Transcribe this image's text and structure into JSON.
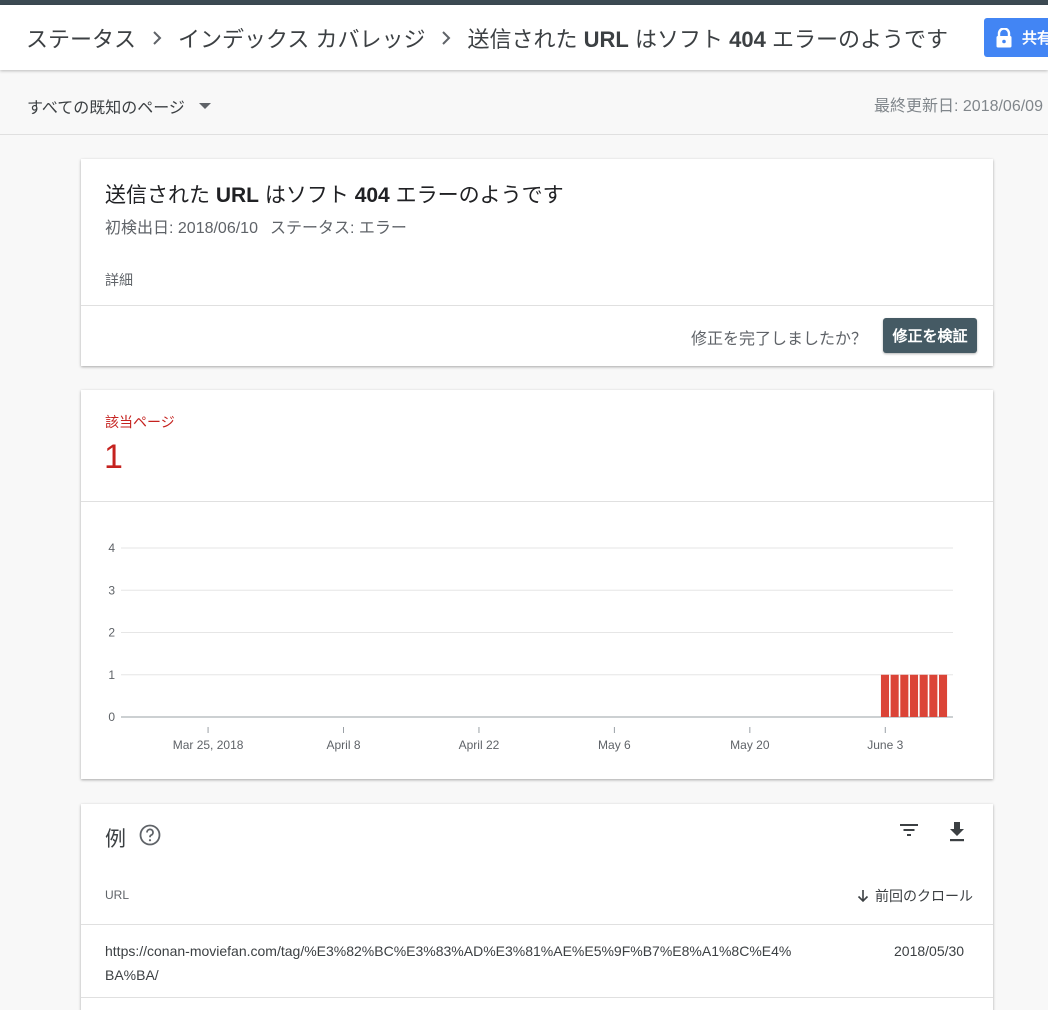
{
  "breadcrumb": {
    "items": [
      "ステータス",
      "インデックス カバレッジ"
    ],
    "current_prefix": "送信された",
    "current_bold1": "URL",
    "current_mid": "はソフト",
    "current_bold2": "404",
    "current_suffix": "エラーのようです"
  },
  "share_button": {
    "label": "共有"
  },
  "subbar": {
    "filter_label": "すべての既知のページ",
    "last_updated": "最終更新日: 2018/06/09"
  },
  "issue": {
    "title_prefix": "送信された",
    "title_bold1": "URL",
    "title_mid": "はソフト",
    "title_bold2": "404",
    "title_suffix": "エラーのようです",
    "first_detected": "初検出日: 2018/06/10",
    "status": "ステータス: エラー",
    "details_label": "詳細",
    "fix_question": "修正を完了しましたか？",
    "validate_button": "修正を検証"
  },
  "affected": {
    "label": "該当ページ",
    "count": "1",
    "color": "#c5221f"
  },
  "chart_data": {
    "type": "bar",
    "x_start": "2018-03-16",
    "x_end": "2018-06-10",
    "x_ticks": [
      {
        "label": "Mar 25, 2018",
        "date": "2018-03-25"
      },
      {
        "label": "April 8",
        "date": "2018-04-08"
      },
      {
        "label": "April 22",
        "date": "2018-04-22"
      },
      {
        "label": "May 6",
        "date": "2018-05-06"
      },
      {
        "label": "May 20",
        "date": "2018-05-20"
      },
      {
        "label": "June 3",
        "date": "2018-06-03"
      }
    ],
    "y_ticks": [
      0,
      1,
      2,
      3,
      4
    ],
    "ylim": [
      0,
      4
    ],
    "bars": [
      {
        "date": "2018-06-03",
        "value": 1
      },
      {
        "date": "2018-06-04",
        "value": 1
      },
      {
        "date": "2018-06-05",
        "value": 1
      },
      {
        "date": "2018-06-06",
        "value": 1
      },
      {
        "date": "2018-06-07",
        "value": 1
      },
      {
        "date": "2018-06-08",
        "value": 1
      },
      {
        "date": "2018-06-09",
        "value": 1
      }
    ],
    "bar_color": "#db4437",
    "grid": true
  },
  "examples": {
    "title": "例",
    "columns": {
      "url": "URL",
      "last_crawl": "前回のクロール"
    },
    "rows": [
      {
        "url": "https://conan-moviefan.com/tag/%E3%82%BC%E3%83%AD%E3%81%AE%E5%9F%B7%E8%A1%8C%E4%BA%BA/",
        "date": "2018/05/30"
      }
    ]
  }
}
